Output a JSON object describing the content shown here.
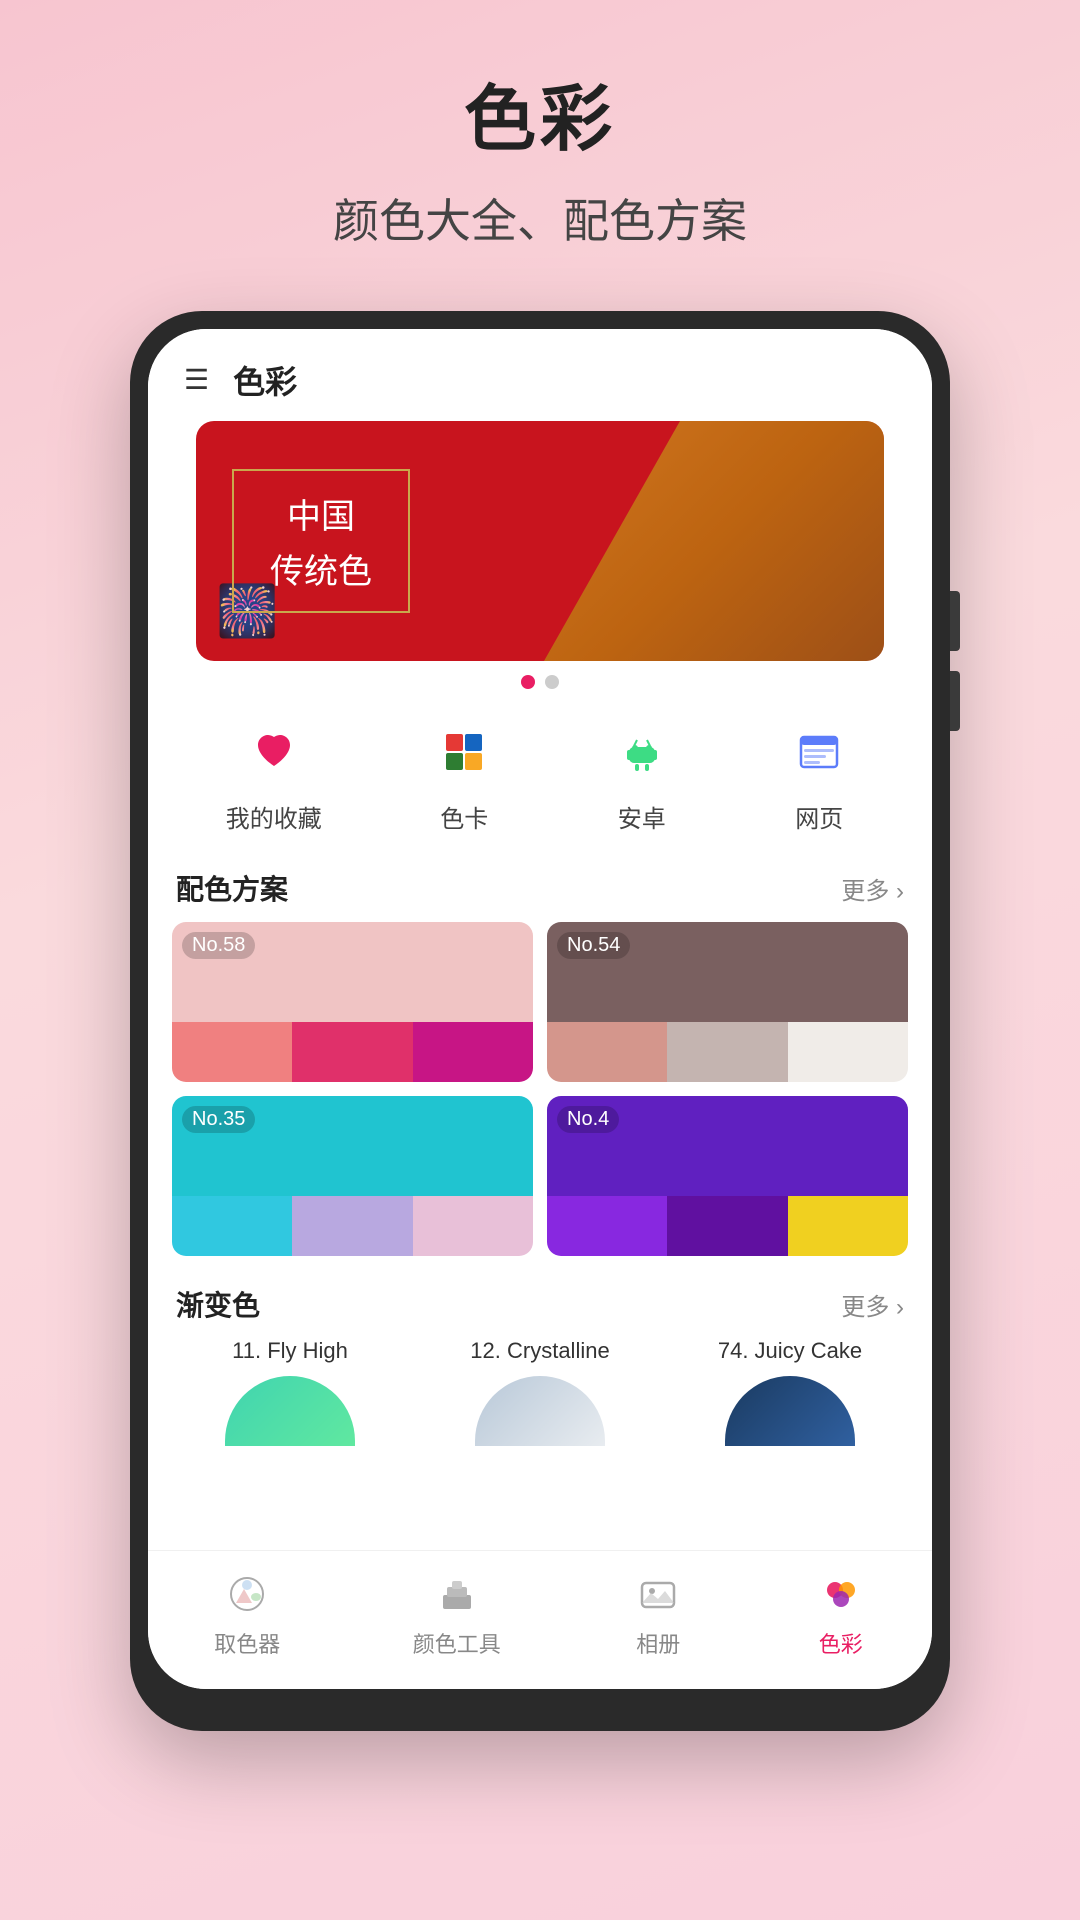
{
  "page": {
    "title": "色彩",
    "subtitle": "颜色大全、配色方案"
  },
  "phone": {
    "topBar": {
      "title": "色彩",
      "menuIcon": "☰"
    },
    "banner": {
      "title": "中国",
      "subtitle": "传统色",
      "dots": [
        {
          "active": true
        },
        {
          "active": false
        }
      ]
    },
    "categories": [
      {
        "label": "我的收藏",
        "icon": "❤️",
        "iconColor": "#e91e63"
      },
      {
        "label": "色卡",
        "icon": "🎨"
      },
      {
        "label": "安卓",
        "icon": "🤖",
        "iconColor": "#3ddc84"
      },
      {
        "label": "网页",
        "icon": "📄"
      }
    ],
    "schemeSection": {
      "title": "配色方案",
      "more": "更多 ›",
      "cards": [
        {
          "no": "No.58",
          "topColor": "#f0c4c4",
          "swatches": [
            "#f08080",
            "#e0306a",
            "#c71585"
          ]
        },
        {
          "no": "No.54",
          "topColor": "#7a6060",
          "swatches": [
            "#d4968c",
            "#c4b4b0",
            "#f0ece8"
          ]
        },
        {
          "no": "No.35",
          "topColor": "#20c4d0",
          "swatches": [
            "#30d8e8",
            "#b8a8e0",
            "#e8c0d8"
          ]
        },
        {
          "no": "No.4",
          "topColor": "#6020c0",
          "swatches": [
            "#8828e0",
            "#6010a0",
            "#f0d020"
          ]
        }
      ]
    },
    "gradientSection": {
      "title": "渐变色",
      "more": "更多 ›",
      "cards": [
        {
          "label": "11. Fly High",
          "gradientStart": "#40d4b0",
          "gradientEnd": "#60e8a0"
        },
        {
          "label": "12. Crystalline",
          "gradientStart": "#c8d8e8",
          "gradientEnd": "#e8ecf0"
        },
        {
          "label": "74. Juicy Cake",
          "gradientStart": "#204878",
          "gradientEnd": "#3060a0"
        }
      ]
    },
    "bottomNav": [
      {
        "label": "取色器",
        "icon": "🎨",
        "active": false
      },
      {
        "label": "颜色工具",
        "icon": "🧰",
        "active": false
      },
      {
        "label": "相册",
        "icon": "🖼️",
        "active": false
      },
      {
        "label": "色彩",
        "icon": "🎨",
        "active": true
      }
    ]
  }
}
